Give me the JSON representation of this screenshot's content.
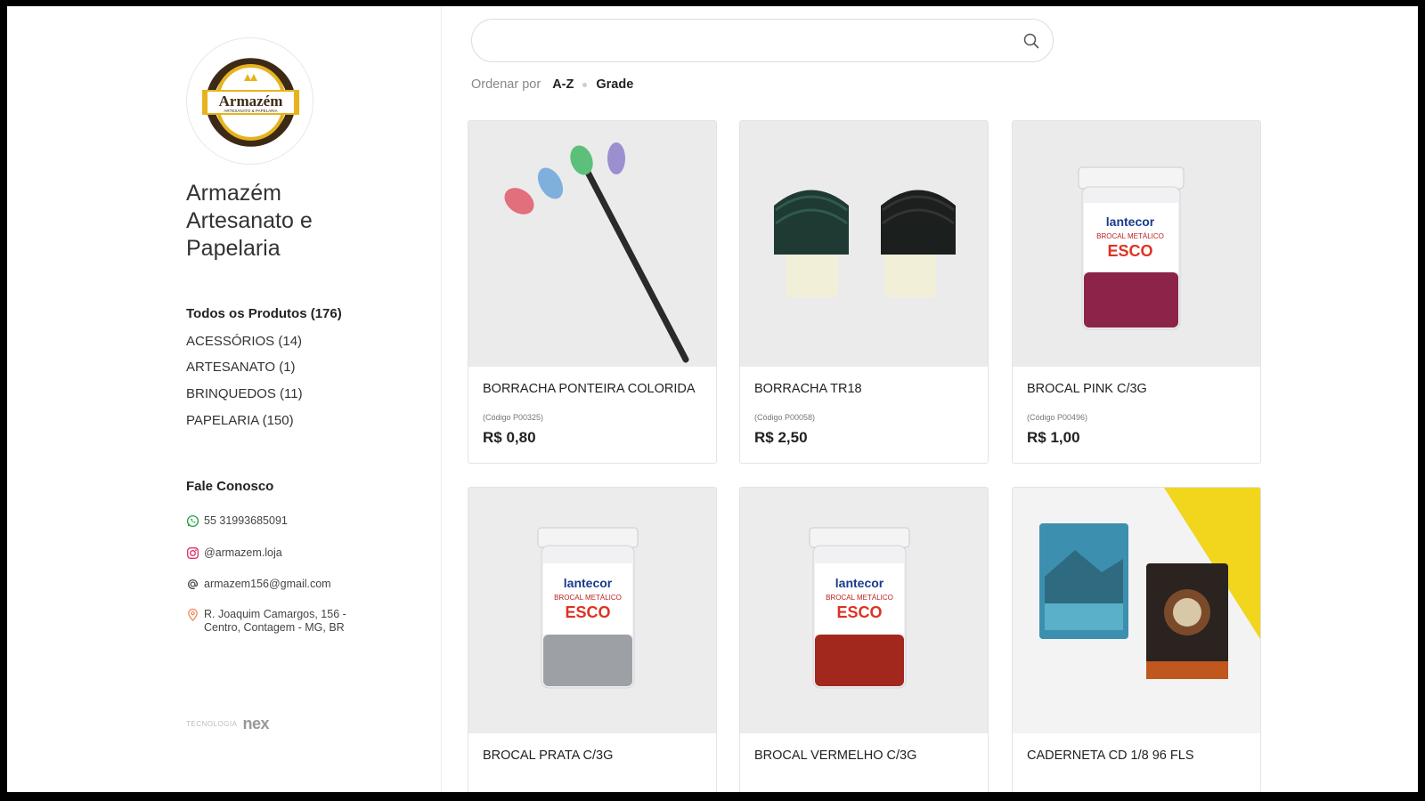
{
  "store": {
    "logo_text": "Armazém",
    "logo_subtext": "ARTESANATO & PAPELARIA",
    "name": "Armazém Artesanato e Papelaria"
  },
  "nav": {
    "all_products": "Todos os Produtos (176)",
    "categories": [
      {
        "label": "ACESSÓRIOS (14)"
      },
      {
        "label": "ARTESANATO (1)"
      },
      {
        "label": "BRINQUEDOS (11)"
      },
      {
        "label": "PAPELARIA (150)"
      }
    ]
  },
  "contact": {
    "title": "Fale Conosco",
    "whatsapp": "55 31993685091",
    "instagram": "@armazem.loja",
    "email": "armazem156@gmail.com",
    "address": "R. Joaquim Camargos, 156 -\nCentro, Contagem - MG, BR"
  },
  "footer": {
    "tech_label": "TECNOLOGIA",
    "tech_brand": "nex"
  },
  "search": {
    "value": "",
    "placeholder": ""
  },
  "sort": {
    "label": "Ordenar por",
    "order": "A-Z",
    "view": "Grade"
  },
  "products": [
    {
      "name": "BORRACHA PONTEIRA COLORIDA",
      "code": "(Código P00325)",
      "price": "R$ 0,80"
    },
    {
      "name": "BORRACHA TR18",
      "code": "(Código P00058)",
      "price": "R$ 2,50"
    },
    {
      "name": "BROCAL PINK C/3G",
      "code": "(Código P00496)",
      "price": "R$ 1,00"
    },
    {
      "name": "BROCAL PRATA C/3G",
      "code": "",
      "price": ""
    },
    {
      "name": "BROCAL VERMELHO C/3G",
      "code": "",
      "price": ""
    },
    {
      "name": "CADERNETA CD 1/8 96 FLS",
      "code": "",
      "price": ""
    }
  ],
  "jar_label": {
    "brand": "lantecor",
    "line": "BROCAL METÁLICO",
    "word": "ESCO"
  },
  "colors": {
    "logo_gold": "#e7b21b",
    "logo_brown": "#3d2a16",
    "whatsapp": "#25a244",
    "instagram": "#e1306c",
    "location": "#f08a5d"
  }
}
